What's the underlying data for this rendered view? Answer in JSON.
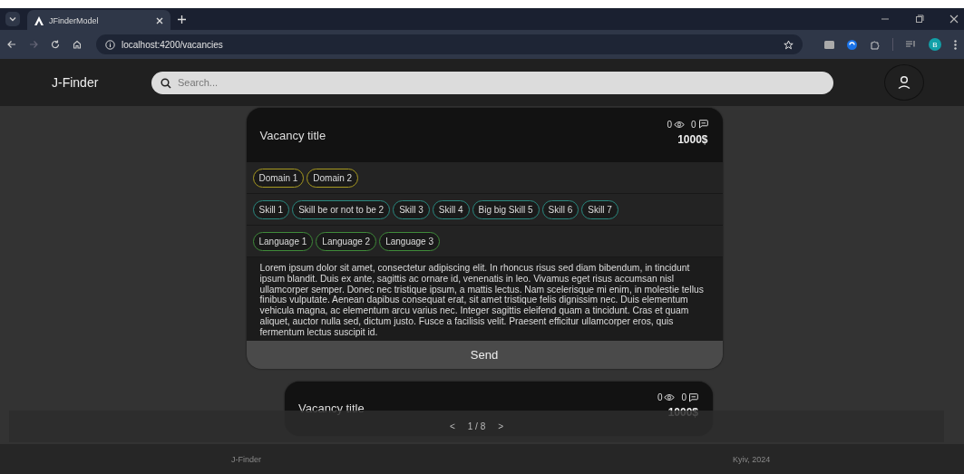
{
  "browser": {
    "tab_title": "JFinderModel",
    "url": "localhost:4200/vacancies",
    "profile_initial": "B"
  },
  "header": {
    "logo": "J-Finder",
    "search": {
      "placeholder": "Search..."
    }
  },
  "vacancies": [
    {
      "title": "Vacancy title",
      "views": "0",
      "comments": "0",
      "salary": "1000$",
      "domains": [
        "Domain 1",
        "Domain 2"
      ],
      "skills": [
        "Skill 1",
        "Skill be or not to be 2",
        "Skill 3",
        "Skill 4",
        "Big big Skill 5",
        "Skill 6",
        "Skill 7"
      ],
      "languages": [
        "Language 1",
        "Language 2",
        "Language 3"
      ],
      "description": "Lorem ipsum dolor sit amet, consectetur adipiscing elit. In rhoncus risus sed diam bibendum, in tincidunt ipsum blandit. Duis ex ante, sagittis ac ornare id, venenatis in leo. Vivamus eget risus accumsan nisl ullamcorper semper. Donec nec tristique ipsum, a mattis lectus. Nam scelerisque mi enim, in molestie tellus finibus vulputate. Aenean dapibus consequat erat, sit amet tristique felis dignissim nec. Duis elementum vehicula magna, ac elementum arcu varius nec. Integer sagittis eleifend quam a tincidunt. Cras et quam aliquet, auctor nulla sed, dictum justo. Fusce a facilisis velit. Praesent efficitur ullamcorper eros, quis fermentum lectus suscipit id.",
      "action": "Send"
    },
    {
      "title": "Vacancy title",
      "views": "0",
      "comments": "0",
      "salary": "1000$"
    }
  ],
  "pagination": {
    "prev": "<",
    "page": "1 / 8",
    "next": ">"
  },
  "footer": {
    "left": "J-Finder",
    "right": "Kyiv, 2024"
  }
}
